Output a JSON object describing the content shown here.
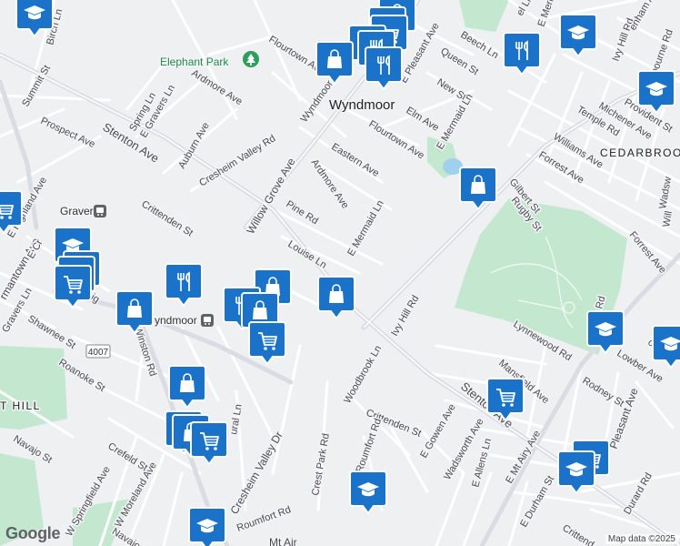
{
  "colors": {
    "background": "#eef0f2",
    "minor_road": "#ffffff",
    "major_road": "#dadce3",
    "park": "#c3e8cf",
    "water": "#9fd1ee",
    "marker": "#1a73c9",
    "label": "#4a4a52"
  },
  "places": {
    "wyndmoor": "Wyndmoor",
    "cedarbrook": "CEDARBROO",
    "chestnut_hill": "T HILL",
    "elephant_park": "Elephant Park",
    "gravers_station": "Gravers",
    "wyndmoor_station": "yndmoor",
    "route": "4007"
  },
  "streets": [
    {
      "id": "birch-ln",
      "text": "Birch Ln"
    },
    {
      "id": "summit-st",
      "text": "Summit St"
    },
    {
      "id": "prospect-ave",
      "text": "Prospect Ave"
    },
    {
      "id": "spring-ln",
      "text": "Spring Ln"
    },
    {
      "id": "e-gravers-ln",
      "text": "E Gravers Ln"
    },
    {
      "id": "ardmore-ave-n",
      "text": "Ardmore Ave"
    },
    {
      "id": "flourtown-ave-n",
      "text": "Flourtown Ave"
    },
    {
      "id": "wyndmoor-ave",
      "text": "Wyndmoor Ave"
    },
    {
      "id": "e-pleasant-ave",
      "text": "E Pleasant Ave"
    },
    {
      "id": "queen-st",
      "text": "Queen St"
    },
    {
      "id": "beech-ln",
      "text": "Beech Ln"
    },
    {
      "id": "new-st",
      "text": "New St"
    },
    {
      "id": "elm-ave",
      "text": "Elm Ave"
    },
    {
      "id": "e-mermaid-ln-n",
      "text": "E Mermaid Ln"
    },
    {
      "id": "flourtown-ave",
      "text": "Flourtown Ave"
    },
    {
      "id": "stenton-ave",
      "text": "Stenton Ave"
    },
    {
      "id": "auburn-ave",
      "text": "Auburn Ave"
    },
    {
      "id": "cresheim-valley-rd",
      "text": "Cresheim Valley Rd"
    },
    {
      "id": "willow-grove-ave",
      "text": "Willow Grove Ave"
    },
    {
      "id": "ardmore-ave",
      "text": "Ardmore Ave"
    },
    {
      "id": "eastern-ave",
      "text": "Eastern Ave"
    },
    {
      "id": "e-highland-ave",
      "text": "E Highland Ave"
    },
    {
      "id": "crittenden-st",
      "text": "Crittenden St"
    },
    {
      "id": "pine-rd",
      "text": "Pine Rd"
    },
    {
      "id": "e-mermaid-ln",
      "text": "E Mermaid Ln"
    },
    {
      "id": "louise-ln",
      "text": "Louise Ln"
    },
    {
      "id": "germantown-ave",
      "text": "rmantown Ave"
    },
    {
      "id": "gravers-ln",
      "text": "Gravers Ln"
    },
    {
      "id": "shawnee-st",
      "text": "Shawnee St"
    },
    {
      "id": "winston-rd",
      "text": "Winston Rd"
    },
    {
      "id": "roanoke-st",
      "text": "Roanoke St"
    },
    {
      "id": "navajo-st",
      "text": "Navajo St"
    },
    {
      "id": "crefeld-st",
      "text": "Crefeld St"
    },
    {
      "id": "w-springfield-ave",
      "text": "W Springfield Ave"
    },
    {
      "id": "w-moreland-ave",
      "text": "W Moreland Ave"
    },
    {
      "id": "navajo-st-s",
      "text": "Navajo St"
    },
    {
      "id": "cresheim-valley-dr",
      "text": "Cresheim Valley Dr"
    },
    {
      "id": "rural-ln",
      "text": "ural Ln"
    },
    {
      "id": "roumfort-rd-sw",
      "text": "Roumfort Rd"
    },
    {
      "id": "crest-park-rd",
      "text": "Crest Park Rd"
    },
    {
      "id": "ivy-hill-rd",
      "text": "Ivy Hill Rd"
    },
    {
      "id": "woodbrook-ln",
      "text": "Woodbrook Ln"
    },
    {
      "id": "crittenden-st-e",
      "text": "Crittenden St"
    },
    {
      "id": "roumfort-rd",
      "text": "Roumfort Rd"
    },
    {
      "id": "e-gowen-ave",
      "text": "E Gowen Ave"
    },
    {
      "id": "wadsworth-ave",
      "text": "Wadsworth Ave"
    },
    {
      "id": "stenton-ave-s",
      "text": "Stenton Ave"
    },
    {
      "id": "e-allens-ln",
      "text": "E Allens Ln"
    },
    {
      "id": "e-mt-airy-ave",
      "text": "E Mt Airy Ave"
    },
    {
      "id": "e-durham-st",
      "text": "E Durham St"
    },
    {
      "id": "lynnewood-rd",
      "text": "Lynnewood Rd"
    },
    {
      "id": "mansfield-ave",
      "text": "Mansfield Ave"
    },
    {
      "id": "rodney-st",
      "text": "Rodney St"
    },
    {
      "id": "lowber-ave",
      "text": "Lowber Ave"
    },
    {
      "id": "pleasant-ave",
      "text": "Pleasant Ave"
    },
    {
      "id": "durard-rd",
      "text": "Durard Rd"
    },
    {
      "id": "ivy-hill-rd-ne",
      "text": "Ivy Hill Rd"
    },
    {
      "id": "provident-st",
      "text": "Provident St"
    },
    {
      "id": "michener-ave",
      "text": "Michener Ave"
    },
    {
      "id": "temple-rd",
      "text": "Temple Rd"
    },
    {
      "id": "williams-ave",
      "text": "Williams Ave"
    },
    {
      "id": "forrest-ave",
      "text": "Forrest Ave"
    },
    {
      "id": "gilbert-st",
      "text": "Gilbert St"
    },
    {
      "id": "rugby-st",
      "text": "Rugby St"
    },
    {
      "id": "forrest-ave-e",
      "text": "Forrest Ave"
    },
    {
      "id": "wadsworth-e",
      "text": "Wadsw"
    },
    {
      "id": "e-mermaid-ne",
      "text": "E Merm"
    },
    {
      "id": "enham-ave",
      "text": "enham Ave"
    },
    {
      "id": "el-ln",
      "text": "el Ln"
    },
    {
      "id": "ashbourne-rd",
      "text": "Ashbourne Rd"
    },
    {
      "id": "crittenden-se",
      "text": "Crittend"
    },
    {
      "id": "woolston",
      "text": "oolston"
    },
    {
      "id": "e-cr",
      "text": "E Cr"
    },
    {
      "id": "leigh",
      "text": "leig"
    },
    {
      "id": "mt-airy",
      "text": "Mt Air"
    },
    {
      "id": "rd-ne",
      "text": "Rd"
    },
    {
      "id": "will",
      "text": "Will"
    }
  ],
  "markers": [
    {
      "id": "school-marker-nw",
      "kind": "school"
    },
    {
      "id": "shop-marker-top-1",
      "kind": "shop"
    },
    {
      "id": "shop-marker-top-2",
      "kind": "shop"
    },
    {
      "id": "cart-marker-top",
      "kind": "cart"
    },
    {
      "id": "restaurant-marker-top-1",
      "kind": "restaurant"
    },
    {
      "id": "restaurant-marker-top-2",
      "kind": "restaurant"
    },
    {
      "id": "restaurant-marker-top-3",
      "kind": "restaurant"
    },
    {
      "id": "shop-marker-wyndmoor",
      "kind": "shop"
    },
    {
      "id": "restaurant-marker-beech",
      "kind": "restaurant"
    },
    {
      "id": "school-marker-beech",
      "kind": "school"
    },
    {
      "id": "school-marker-provident",
      "kind": "school"
    },
    {
      "id": "shop-marker-flourtown",
      "kind": "shop"
    },
    {
      "id": "cart-marker-west-edge",
      "kind": "cart"
    },
    {
      "id": "school-marker-gravers",
      "kind": "school"
    },
    {
      "id": "cart-marker-gravers-1",
      "kind": "cart"
    },
    {
      "id": "cart-marker-gravers-2",
      "kind": "cart"
    },
    {
      "id": "cart-marker-gravers-3",
      "kind": "cart"
    },
    {
      "id": "restaurant-marker-center",
      "kind": "restaurant"
    },
    {
      "id": "shop-marker-center-1",
      "kind": "shop"
    },
    {
      "id": "restaurant-marker-center-2",
      "kind": "restaurant"
    },
    {
      "id": "shop-marker-louise",
      "kind": "shop"
    },
    {
      "id": "shop-marker-center-2",
      "kind": "shop"
    },
    {
      "id": "cart-marker-center",
      "kind": "cart"
    },
    {
      "id": "shop-marker-west",
      "kind": "shop"
    },
    {
      "id": "shop-marker-southwest-1",
      "kind": "shop"
    },
    {
      "id": "shop-marker-southwest-2",
      "kind": "shop"
    },
    {
      "id": "shop-marker-southwest-3",
      "kind": "shop"
    },
    {
      "id": "cart-marker-southwest",
      "kind": "cart"
    },
    {
      "id": "school-marker-southwest",
      "kind": "school"
    },
    {
      "id": "school-marker-crest",
      "kind": "school"
    },
    {
      "id": "cart-marker-stenton",
      "kind": "cart"
    },
    {
      "id": "school-marker-lowber",
      "kind": "school"
    },
    {
      "id": "school-marker-east-edge",
      "kind": "school"
    },
    {
      "id": "cart-marker-mt-airy",
      "kind": "cart"
    },
    {
      "id": "school-marker-mt-airy",
      "kind": "school"
    }
  ],
  "attribution": {
    "logo": "Google",
    "text": "Map data ©2025"
  }
}
